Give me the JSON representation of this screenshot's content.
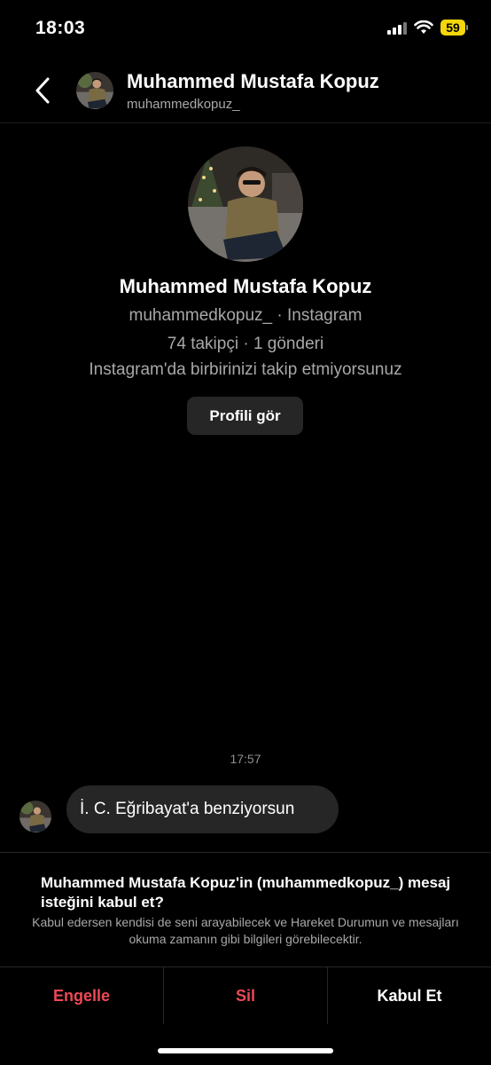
{
  "status_bar": {
    "time": "18:03",
    "battery": "59",
    "battery_color": "#f5d60a"
  },
  "header": {
    "name": "Muhammed Mustafa Kopuz",
    "username": "muhammedkopuz_"
  },
  "profile": {
    "name": "Muhammed Mustafa Kopuz",
    "subtitle": "muhammedkopuz_ · Instagram",
    "stats": "74 takipçi · 1 gönderi",
    "follow_note": "Instagram'da birbirinizi takip etmiyorsunuz",
    "view_profile_label": "Profili gör"
  },
  "thread": {
    "timestamp": "17:57",
    "message": "İ. C. Eğribayat'a benziyorsun"
  },
  "request": {
    "title": "Muhammed Mustafa Kopuz'in (muhammedkopuz_) mesaj isteğini kabul et?",
    "description": "Kabul edersen kendisi de seni arayabilecek ve Hareket Durumun ve mesajları okuma zamanın gibi bilgileri görebilecektir."
  },
  "actions": {
    "block_label": "Engelle",
    "delete_label": "Sil",
    "accept_label": "Kabul Et",
    "danger_color": "#ed4956"
  }
}
